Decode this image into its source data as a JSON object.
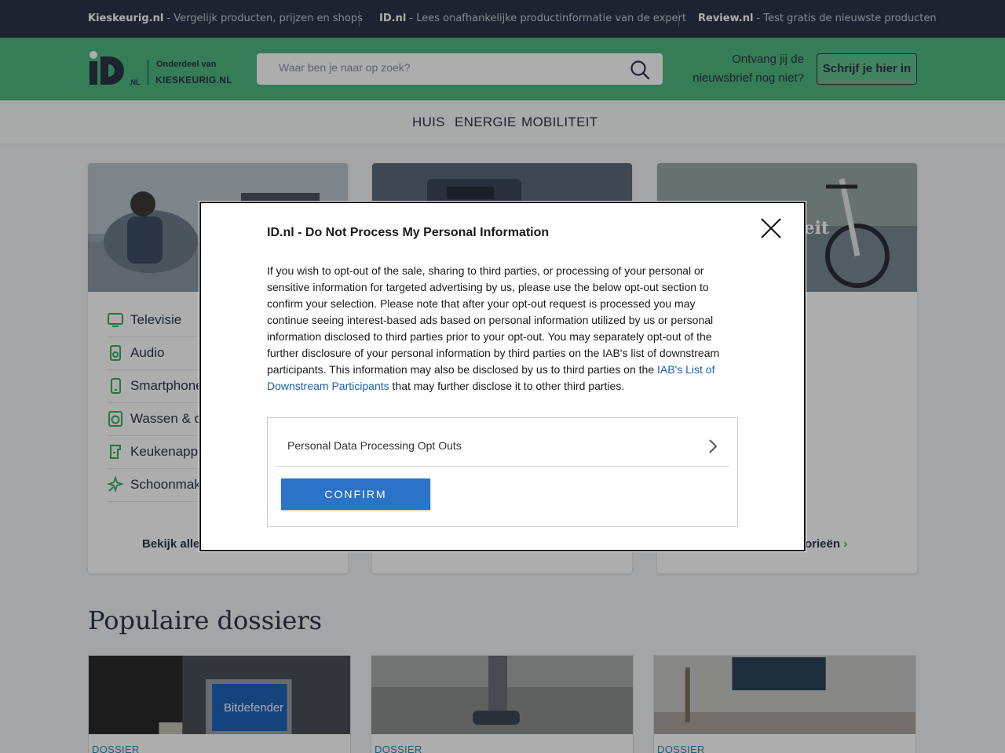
{
  "topbar": {
    "items": [
      {
        "brand": "Kieskeurig.nl",
        "text": " - Vergelijk producten, prijzen en shops"
      },
      {
        "brand": "ID.nl",
        "text": " - Lees onafhankelijke productinformatie van de expert"
      },
      {
        "brand": "Review.nl",
        "text": " - Test gratis de nieuwste producten"
      }
    ]
  },
  "header": {
    "logo_sub_1": "Onderdeel van",
    "logo_sub_2": "KIESKEURIG.NL",
    "search_placeholder": "Waar ben je naar op zoek?",
    "newsletter_text_1": "Ontvang jij de",
    "newsletter_text_2": "nieuwsbrief nog niet?",
    "newsletter_button": "Schrijf je hier in"
  },
  "nav": {
    "links": [
      "HUIS",
      "ENERGIE",
      "MOBILITEIT"
    ]
  },
  "cards": [
    {
      "categories": [
        {
          "label": "Televisie",
          "icon": "tv-icon"
        },
        {
          "label": "Audio",
          "icon": "speaker-icon"
        },
        {
          "label": "Smartphone",
          "icon": "smartphone-icon"
        },
        {
          "label": "Wassen & d",
          "icon": "washing-machine-icon"
        },
        {
          "label": "Keukenapp",
          "icon": "kitchen-appliance-icon"
        },
        {
          "label": "Schoonmak",
          "icon": "cleaning-icon"
        }
      ],
      "more_link": "Bekijk alle"
    },
    {
      "categories": [],
      "more_link": ""
    },
    {
      "overlay_title": "eit",
      "categories": [],
      "more_link": "orieën"
    }
  ],
  "section": {
    "title": "Populaire dossiers"
  },
  "dossiers": [
    {
      "tag": "DOSSIER",
      "image_text": "Bitdefender"
    },
    {
      "tag": "DOSSIER"
    },
    {
      "tag": "DOSSIER"
    }
  ],
  "modal": {
    "title": "ID.nl - Do Not Process My Personal Information",
    "body": "If you wish to opt-out of the sale, sharing to third parties, or processing of your personal or sensitive information for targeted advertising by us, please use the below opt-out section to confirm your selection. Please note that after your opt-out request is processed you may continue seeing interest-based ads based on personal information utilized by us or personal information disclosed to third parties prior to your opt-out. You may separately opt-out of the further disclosure of your personal information by third parties on the IAB's list of downstream participants. This information may also be disclosed by us to third parties on the ",
    "link_text": "IAB's List of Downstream Participants",
    "body_end": " that may further disclose it to other third parties.",
    "option_label": "Personal Data Processing Opt Outs",
    "confirm_label": "CONFIRM"
  },
  "colors": {
    "topbar": "#2b3447",
    "header_green": "#4fb87f",
    "accent_icon_green": "#3aa86b",
    "confirm_blue": "#2a73c9",
    "link_blue": "#1a5fa8"
  }
}
